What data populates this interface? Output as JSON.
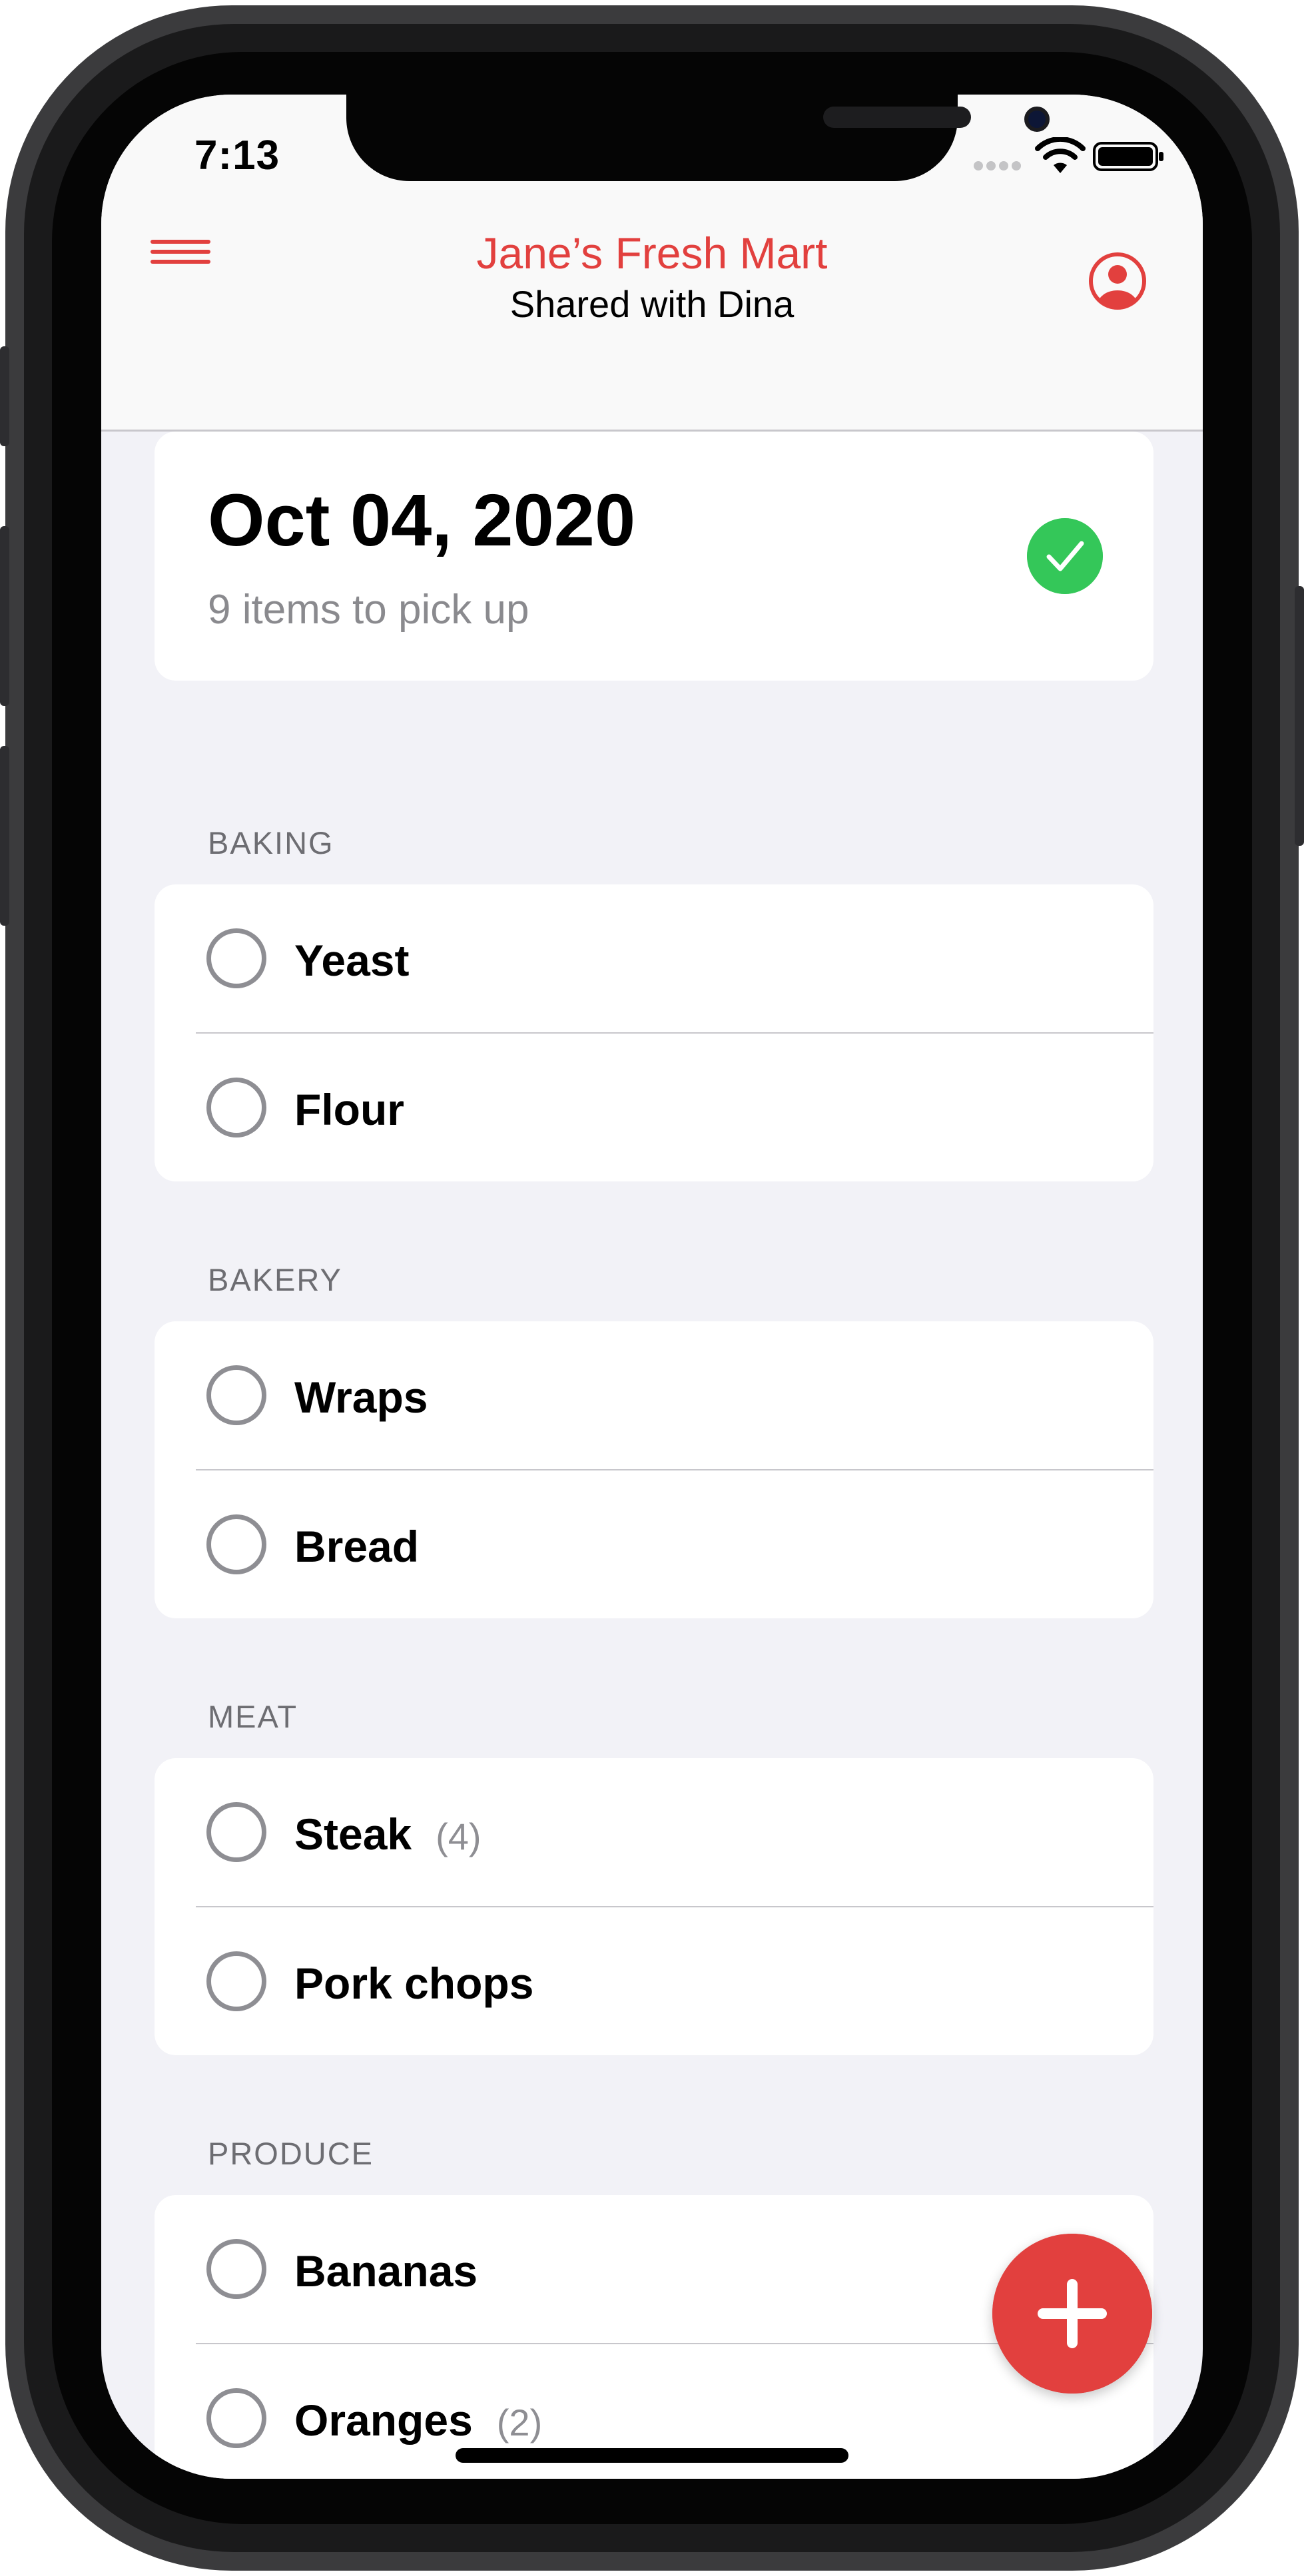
{
  "statusbar": {
    "time": "7:13"
  },
  "navbar": {
    "title": "Jane’s Fresh Mart",
    "subtitle": "Shared with Dina"
  },
  "summary": {
    "date": "Oct 04, 2020",
    "items_text": "9 items to pick up"
  },
  "sections": [
    {
      "header": "BAKING",
      "items": [
        {
          "label": "Yeast"
        },
        {
          "label": "Flour"
        }
      ]
    },
    {
      "header": "BAKERY",
      "items": [
        {
          "label": "Wraps"
        },
        {
          "label": "Bread"
        }
      ]
    },
    {
      "header": "MEAT",
      "items": [
        {
          "label": "Steak",
          "qty": "(4)"
        },
        {
          "label": "Pork chops"
        }
      ]
    },
    {
      "header": "PRODUCE",
      "items": [
        {
          "label": "Bananas"
        },
        {
          "label": "Oranges",
          "qty": "(2)"
        }
      ]
    }
  ],
  "colors": {
    "accent": "#e2403e",
    "success": "#34c759",
    "background": "#f2f2f7"
  },
  "icons": {
    "menu": "hamburger-menu-icon",
    "profile": "person-circle-icon",
    "complete": "checkmark-circle-icon",
    "add": "plus-icon"
  }
}
